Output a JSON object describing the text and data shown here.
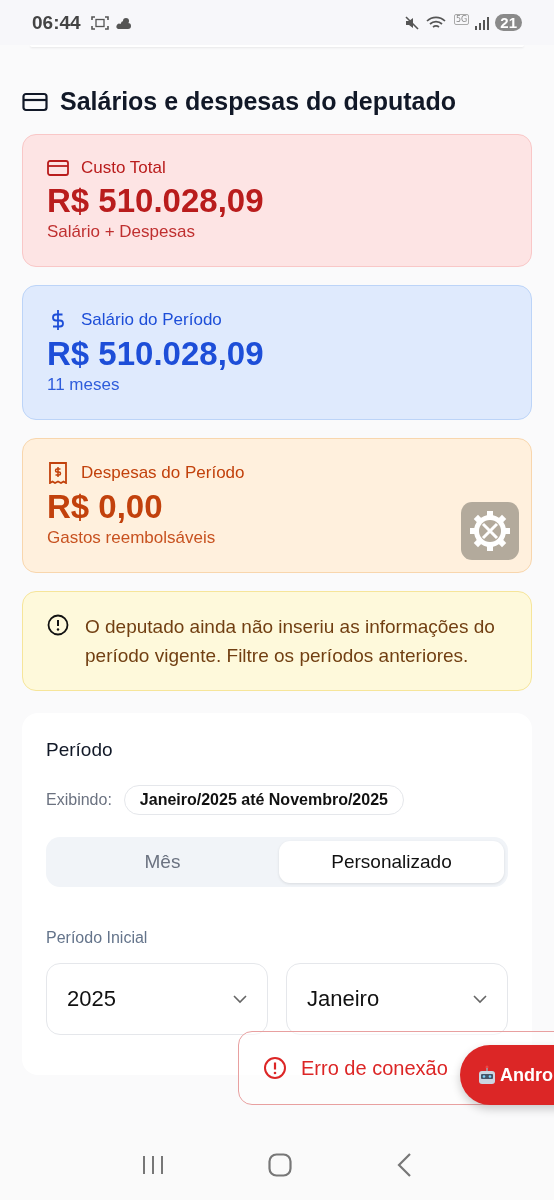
{
  "status_bar": {
    "time": "06:44",
    "battery": "21",
    "network": "5G"
  },
  "section": {
    "title": "Salários e despesas do deputado"
  },
  "cards": [
    {
      "kind": "total",
      "label": "Custo Total",
      "amount": "R$ 510.028,09",
      "note": "Salário + Despesas"
    },
    {
      "kind": "salary",
      "label": "Salário do Período",
      "amount": "R$ 510.028,09",
      "note": "11 meses"
    },
    {
      "kind": "expenses",
      "label": "Despesas do Período",
      "amount": "R$ 0,00",
      "note": "Gastos reembolsáveis"
    }
  ],
  "notice": "O deputado ainda não inseriu as informações do período vigente. Filtre os períodos anteriores.",
  "period": {
    "title": "Período",
    "showing_label": "Exibindo:",
    "showing_value": "Janeiro/2025 até Novembro/2025",
    "tabs": [
      {
        "label": "Mês",
        "selected": false
      },
      {
        "label": "Personalizado",
        "selected": true
      }
    ],
    "start_label": "Período Inicial",
    "year": "2025",
    "month": "Janeiro"
  },
  "toast": {
    "message": "Erro de conexão"
  },
  "floating_button": {
    "label": "Andro"
  }
}
